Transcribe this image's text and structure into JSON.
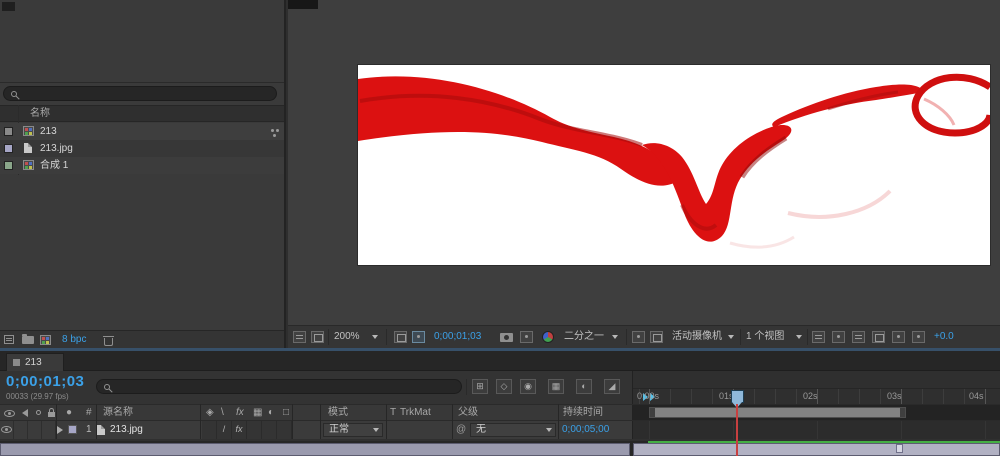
{
  "colors": {
    "accent_blue": "#3ba1e8",
    "ink_red": "#dd1111",
    "label_lavender": "#a6a6c6",
    "cache_green": "#44b044",
    "playhead_red": "#c84040"
  },
  "project_panel": {
    "name_header": "名称",
    "items": [
      {
        "label": "213",
        "type": "composition"
      },
      {
        "label": "213.jpg",
        "type": "footage"
      },
      {
        "label": "合成 1",
        "type": "composition"
      }
    ],
    "footer": {
      "bit_depth": "8 bpc"
    }
  },
  "viewer": {
    "toolbar": {
      "zoom": "200%",
      "time": "0;00;01;03",
      "resolution": "二分之一",
      "camera_view": "活动摄像机",
      "view_layout": "1 个视图",
      "exposure": "+0.0"
    }
  },
  "timeline": {
    "tab_label": "213",
    "current_time": "0;00;01;03",
    "frame_info": "00033 (29.97 fps)",
    "columns": {
      "hash": "#",
      "source_name": "源名称",
      "mode": "模式",
      "t": "T",
      "trkmat": "TrkMat",
      "parent": "父级",
      "duration": "持续时间"
    },
    "switch_icons": [
      "◈",
      "\\",
      "fx",
      "▦",
      "◐",
      "□"
    ],
    "layers": [
      {
        "index": "1",
        "name": "213.jpg",
        "quality": "/",
        "fx": "fx",
        "mode": "正常",
        "parent": "无",
        "duration": "0;00;05;00"
      }
    ],
    "ruler_labels": [
      "0:00s",
      "01s",
      "02s",
      "03s",
      "04s"
    ]
  }
}
